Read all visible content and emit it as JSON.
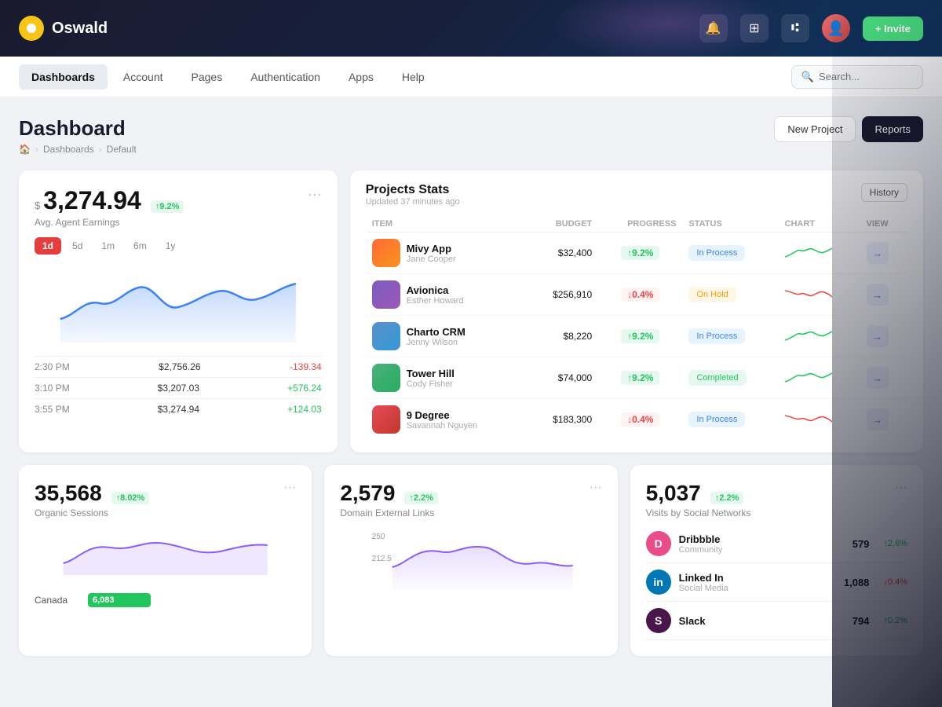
{
  "topbar": {
    "logo_text": "Oswald",
    "invite_label": "+ Invite"
  },
  "nav": {
    "items": [
      {
        "label": "Dashboards",
        "active": true
      },
      {
        "label": "Account",
        "active": false
      },
      {
        "label": "Pages",
        "active": false
      },
      {
        "label": "Authentication",
        "active": false
      },
      {
        "label": "Apps",
        "active": false
      },
      {
        "label": "Help",
        "active": false
      }
    ],
    "search_placeholder": "Search..."
  },
  "page_header": {
    "title": "Dashboard",
    "breadcrumb": [
      "Home",
      "Dashboards",
      "Default"
    ],
    "btn_new": "New Project",
    "btn_reports": "Reports"
  },
  "earnings_card": {
    "currency_symbol": "$",
    "amount": "3,274.94",
    "badge": "↑9.2%",
    "subtitle": "Avg. Agent Earnings",
    "more": "···",
    "time_filters": [
      "1d",
      "5d",
      "1m",
      "6m",
      "1y"
    ],
    "active_filter": "1d",
    "chart_rows": [
      {
        "time": "2:30 PM",
        "value": "$2,756.26",
        "change": "-139.34",
        "negative": true
      },
      {
        "time": "3:10 PM",
        "value": "$3,207.03",
        "change": "+576.24",
        "negative": false
      },
      {
        "time": "3:55 PM",
        "value": "$3,274.94",
        "change": "+124.03",
        "negative": false
      }
    ]
  },
  "projects_card": {
    "title": "Projects Stats",
    "updated": "Updated 37 minutes ago",
    "history_btn": "History",
    "columns": [
      "ITEM",
      "BUDGET",
      "PROGRESS",
      "STATUS",
      "CHART",
      "VIEW"
    ],
    "rows": [
      {
        "name": "Mivy App",
        "person": "Jane Cooper",
        "budget": "$32,400",
        "progress": "↑9.2%",
        "progress_up": true,
        "status": "In Process",
        "status_type": "inprocess",
        "color": "#ff6b35"
      },
      {
        "name": "Avionica",
        "person": "Esther Howard",
        "budget": "$256,910",
        "progress": "↓0.4%",
        "progress_up": false,
        "status": "On Hold",
        "status_type": "onhold",
        "color": "#7c5cbf"
      },
      {
        "name": "Charto CRM",
        "person": "Jenny Wilson",
        "budget": "$8,220",
        "progress": "↑9.2%",
        "progress_up": true,
        "status": "In Process",
        "status_type": "inprocess",
        "color": "#5b8fc9"
      },
      {
        "name": "Tower Hill",
        "person": "Cody Fisher",
        "budget": "$74,000",
        "progress": "↑9.2%",
        "progress_up": true,
        "status": "Completed",
        "status_type": "completed",
        "color": "#4caf7d"
      },
      {
        "name": "9 Degree",
        "person": "Savannah Nguyen",
        "budget": "$183,300",
        "progress": "↓0.4%",
        "progress_up": false,
        "status": "In Process",
        "status_type": "inprocess",
        "color": "#e64a5a"
      }
    ]
  },
  "organic_card": {
    "value": "35,568",
    "badge": "↑8.02%",
    "label": "Organic Sessions",
    "more": "···",
    "geo_rows": [
      {
        "country": "Canada",
        "value": "6,083"
      }
    ]
  },
  "external_links_card": {
    "value": "2,579",
    "badge": "↑2.2%",
    "label": "Domain External Links",
    "more": "···"
  },
  "social_card": {
    "value": "5,037",
    "badge": "↑2.2%",
    "label": "Visits by Social Networks",
    "more": "···",
    "networks": [
      {
        "name": "Dribbble",
        "type": "Community",
        "count": "579",
        "change": "↑2.6%",
        "up": true,
        "color": "#ea4c89",
        "abbr": "D"
      },
      {
        "name": "Linked In",
        "type": "Social Media",
        "count": "1,088",
        "change": "↓0.4%",
        "up": false,
        "color": "#0077b5",
        "abbr": "in"
      },
      {
        "name": "Slack",
        "type": "",
        "count": "794",
        "change": "↑0.2%",
        "up": true,
        "color": "#4a154b",
        "abbr": "S"
      }
    ]
  },
  "colors": {
    "green": "#22c55e",
    "red": "#ef4444",
    "blue": "#3b82f6",
    "yellow": "#f59e0b",
    "dark": "#1a1a2e",
    "accent_green": "#4ade80"
  }
}
